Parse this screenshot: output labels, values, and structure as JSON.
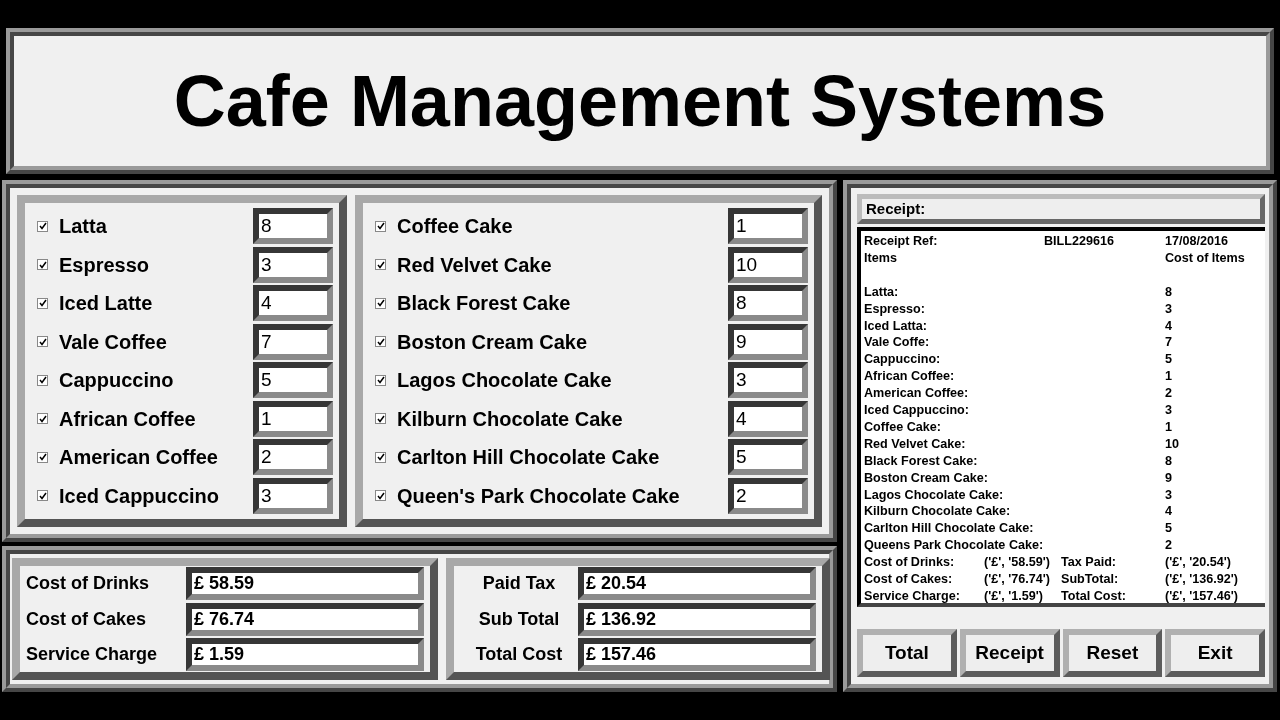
{
  "title": "Cafe Management Systems",
  "drinks": [
    {
      "name": "Latta",
      "checked": true,
      "qty": "8"
    },
    {
      "name": "Espresso",
      "checked": true,
      "qty": "3"
    },
    {
      "name": "Iced Latte",
      "checked": true,
      "qty": "4"
    },
    {
      "name": "Vale Coffee",
      "checked": true,
      "qty": "7"
    },
    {
      "name": "Cappuccino",
      "checked": true,
      "qty": "5"
    },
    {
      "name": "African Coffee",
      "checked": true,
      "qty": "1"
    },
    {
      "name": "American Coffee",
      "checked": true,
      "qty": "2"
    },
    {
      "name": "Iced Cappuccino",
      "checked": true,
      "qty": "3"
    }
  ],
  "cakes": [
    {
      "name": "Coffee Cake",
      "checked": true,
      "qty": "1"
    },
    {
      "name": "Red Velvet Cake",
      "checked": true,
      "qty": "10"
    },
    {
      "name": "Black Forest Cake",
      "checked": true,
      "qty": "8"
    },
    {
      "name": "Boston Cream Cake",
      "checked": true,
      "qty": "9"
    },
    {
      "name": "Lagos Chocolate Cake",
      "checked": true,
      "qty": "3"
    },
    {
      "name": "Kilburn Chocolate Cake",
      "checked": true,
      "qty": "4"
    },
    {
      "name": "Carlton Hill Chocolate Cake",
      "checked": true,
      "qty": "5"
    },
    {
      "name": "Queen's Park Chocolate Cake",
      "checked": true,
      "qty": "2"
    }
  ],
  "costs": [
    {
      "label": "Cost of Drinks",
      "value": "£ 58.59"
    },
    {
      "label": "Cost of Cakes",
      "value": "£ 76.74"
    },
    {
      "label": "Service Charge",
      "value": "£ 1.59"
    }
  ],
  "totals": [
    {
      "label": "Paid Tax",
      "value": "£ 20.54"
    },
    {
      "label": "Sub Total",
      "value": "£ 136.92"
    },
    {
      "label": "Total Cost",
      "value": "£ 157.46"
    }
  ],
  "receipt": {
    "label": "Receipt:",
    "ref_label": "Receipt Ref:",
    "ref": "BILL229616",
    "date": "17/08/2016",
    "items_heading": "Items",
    "cost_heading": "Cost of Items",
    "items": [
      {
        "name": "Latta:",
        "qty": "8"
      },
      {
        "name": "Espresso:",
        "qty": "3"
      },
      {
        "name": "Iced Latta:",
        "qty": "4"
      },
      {
        "name": "Vale Coffe:",
        "qty": "7"
      },
      {
        "name": "Cappuccino:",
        "qty": "5"
      },
      {
        "name": "African Coffee:",
        "qty": "1"
      },
      {
        "name": "American Coffee:",
        "qty": "2"
      },
      {
        "name": "Iced Cappuccino:",
        "qty": "3"
      },
      {
        "name": "Coffee Cake:",
        "qty": "1"
      },
      {
        "name": "Red Velvet Cake:",
        "qty": "10"
      },
      {
        "name": "Black Forest Cake:",
        "qty": "8"
      },
      {
        "name": "Boston Cream Cake:",
        "qty": "9"
      },
      {
        "name": "Lagos Chocolate Cake:",
        "qty": "3"
      },
      {
        "name": "Kilburn Chocolate Cake:",
        "qty": "4"
      },
      {
        "name": "Carlton Hill Chocolate Cake:",
        "qty": "5"
      },
      {
        "name": "Queens Park Chocolate Cake:",
        "qty": "2"
      }
    ],
    "totals": [
      [
        "Cost of Drinks:",
        "('£', '58.59')",
        "Tax Paid:",
        "('£', '20.54')"
      ],
      [
        "Cost of Cakes:",
        "('£', '76.74')",
        "SubTotal:",
        "('£', '136.92')"
      ],
      [
        "Service Charge:",
        "('£', '1.59')",
        "Total Cost:",
        "('£', '157.46')"
      ]
    ]
  },
  "buttons": [
    "Total",
    "Receipt",
    "Reset",
    "Exit"
  ]
}
